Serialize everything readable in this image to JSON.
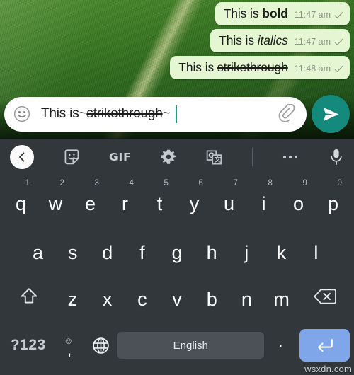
{
  "app": {
    "name": "whatsapp-chat",
    "watermark": "wsxdn.com"
  },
  "chat": {
    "messages": [
      {
        "prefix": "This is ",
        "styled": "bold",
        "style": "bold",
        "time": "11:47 am",
        "status_icon": "single-check"
      },
      {
        "prefix": "This is ",
        "styled": "italics",
        "style": "italic",
        "time": "11:47 am",
        "status_icon": "single-check"
      },
      {
        "prefix": "This is ",
        "styled": "strikethrough",
        "style": "strikethrough",
        "time": "11:48 am",
        "status_icon": "single-check"
      }
    ],
    "bubble_color": "#e4f7d2",
    "time_color": "#8d9488"
  },
  "composer": {
    "emoji_icon": "smiley-face-icon",
    "text_plain": "This is ",
    "text_marked_open": "~",
    "text_marked": "strikethrough",
    "text_marked_close": "~",
    "full_value": "This is ~strikethrough~",
    "attach_icon": "paperclip-icon",
    "send_icon": "send-plane-icon",
    "send_color": "#138a7c",
    "caret_color": "#18a08b"
  },
  "keyboard_toolbar": {
    "items": [
      {
        "name": "back-chevron-icon",
        "label": ""
      },
      {
        "name": "sticker-icon",
        "label": ""
      },
      {
        "name": "gif-icon",
        "label": "GIF"
      },
      {
        "name": "settings-gear-icon",
        "label": ""
      },
      {
        "name": "translate-icon",
        "label": ""
      },
      {
        "name": "divider",
        "label": ""
      },
      {
        "name": "more-options-icon",
        "label": ""
      },
      {
        "name": "microphone-icon",
        "label": ""
      }
    ]
  },
  "keyboard": {
    "background": "#32373c",
    "row1": [
      {
        "key": "q",
        "num": "1"
      },
      {
        "key": "w",
        "num": "2"
      },
      {
        "key": "e",
        "num": "3"
      },
      {
        "key": "r",
        "num": "4"
      },
      {
        "key": "t",
        "num": "5"
      },
      {
        "key": "y",
        "num": "6"
      },
      {
        "key": "u",
        "num": "7"
      },
      {
        "key": "i",
        "num": "8"
      },
      {
        "key": "o",
        "num": "9"
      },
      {
        "key": "p",
        "num": "0"
      }
    ],
    "row2": [
      {
        "key": "a"
      },
      {
        "key": "s"
      },
      {
        "key": "d"
      },
      {
        "key": "f"
      },
      {
        "key": "g"
      },
      {
        "key": "h"
      },
      {
        "key": "j"
      },
      {
        "key": "k"
      },
      {
        "key": "l"
      }
    ],
    "row3": [
      {
        "key": "z"
      },
      {
        "key": "x"
      },
      {
        "key": "c"
      },
      {
        "key": "v"
      },
      {
        "key": "b"
      },
      {
        "key": "n"
      },
      {
        "key": "m"
      }
    ],
    "shift_icon": "shift-arrow-icon",
    "backspace_icon": "backspace-icon",
    "row4": {
      "symbols_label": "?123",
      "emoji_comma": ",",
      "language_icon": "globe-icon",
      "space_label": "English",
      "period_label": ".",
      "enter_icon": "enter-return-icon",
      "enter_color": "#7fa6e8",
      "space_color": "#4b5157"
    }
  }
}
